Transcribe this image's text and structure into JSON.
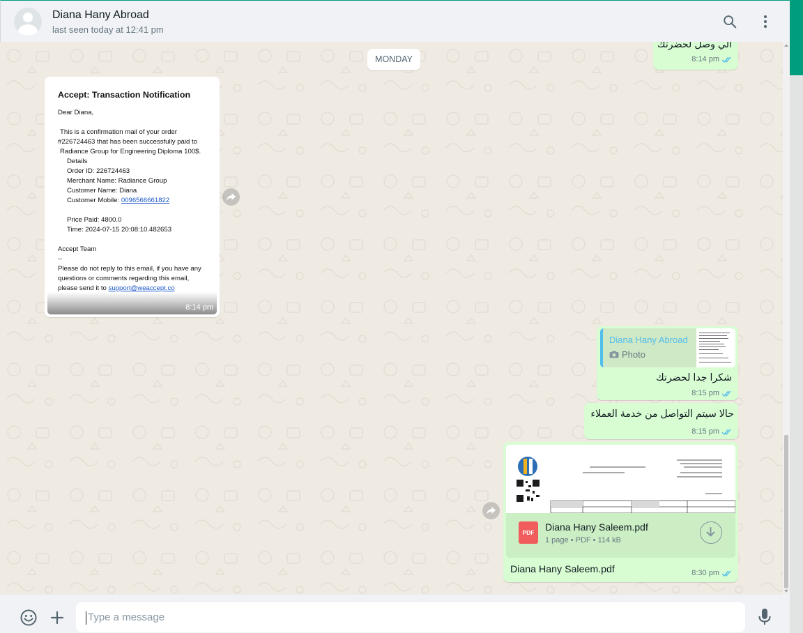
{
  "header": {
    "contact_name": "Diana Hany Abroad",
    "contact_status": "last seen today at 12:41 pm"
  },
  "chat": {
    "day_label": "MONDAY",
    "messages": [
      {
        "id": "m1",
        "direction": "outgoing",
        "text": "الي وصل لحضرتك",
        "time": "8:14 pm",
        "status": "read"
      },
      {
        "id": "m2",
        "direction": "incoming",
        "type": "image",
        "time": "8:14 pm",
        "image_text": {
          "title": "Accept: Transaction Notification",
          "greeting": "Dear Diana,",
          "line1": "This is a confirmation mail of your order",
          "line2": "#226724463 that has been successfully paid to",
          "line3": "Radiance Group for Engineering Diploma 100$.",
          "details": "Details",
          "order_id": "Order ID: 226724463",
          "merchant": "Merchant Name: Radiance Group",
          "customer_name": "Customer Name: Diana",
          "mobile_label": "Customer Mobile: ",
          "mobile_value": "0096566661822",
          "price": "Price Paid: 4800.0",
          "time_line": "Time: 2024-07-15 20:08:10.482653",
          "team": "Accept Team",
          "dash": "--",
          "note1": "Please do not reply to this email, if you have any",
          "note2": "questions or comments regarding this email,",
          "note3_prefix": "please send it to ",
          "support_email": "support@weaccept.co"
        }
      },
      {
        "id": "m3",
        "direction": "outgoing",
        "type": "reply",
        "quoted_name": "Diana Hany Abroad",
        "quoted_type": "Photo",
        "text": "شكرا جدا لحضرتك",
        "time": "8:15 pm",
        "status": "read"
      },
      {
        "id": "m4",
        "direction": "outgoing",
        "text": "حالا سيتم التواصل من خدمة العملاء",
        "time": "8:15 pm",
        "status": "read"
      },
      {
        "id": "m5",
        "direction": "outgoing",
        "type": "document",
        "file_name": "Diana Hany Saleem.pdf",
        "file_badge": "PDF",
        "file_info": "1 page • PDF • 114 kB",
        "caption": "Diana Hany Saleem.pdf",
        "time": "8:30 pm",
        "status": "read"
      }
    ]
  },
  "composer": {
    "placeholder": "Type a message"
  },
  "colors": {
    "accent": "#009e7e",
    "outgoing_bubble": "#d9fdd3",
    "read_ticks": "#53bdeb",
    "chat_background": "#efeae2"
  },
  "icons": [
    "search-icon",
    "menu-icon",
    "emoji-icon",
    "attach-icon",
    "mic-icon",
    "forward-icon",
    "download-icon",
    "camera-icon",
    "double-check-icon"
  ]
}
